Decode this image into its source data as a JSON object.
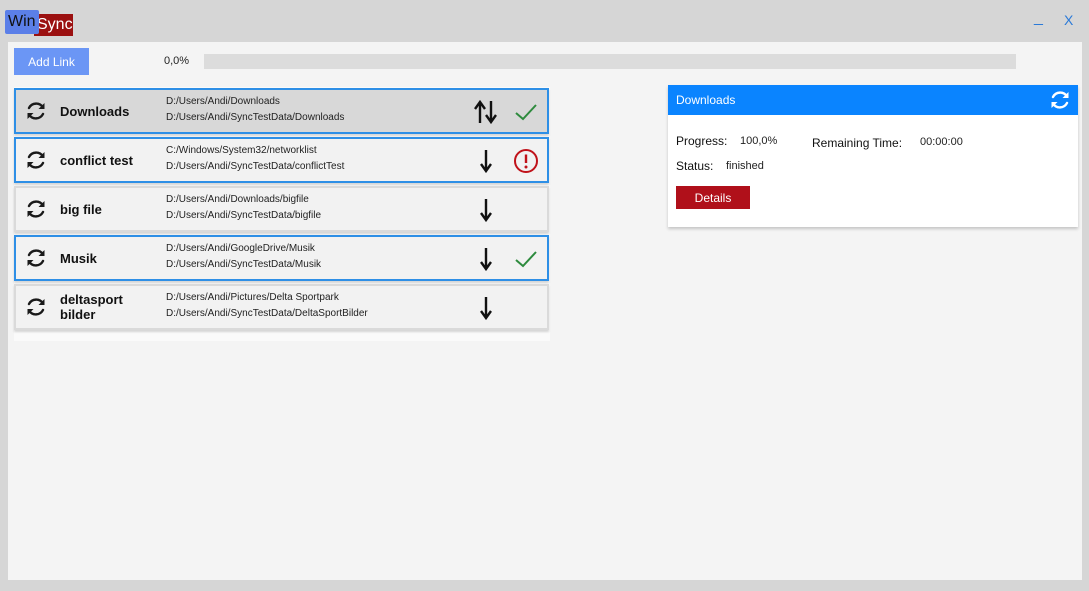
{
  "app": {
    "logo_win": "Win",
    "logo_sync": "Sync",
    "minimize": "_",
    "close": "X"
  },
  "toolbar": {
    "add_link_label": "Add Link",
    "overall_progress_text": "0,0%",
    "overall_progress_value": 0
  },
  "links": [
    {
      "name": "Downloads",
      "source": "D:/Users/Andi/Downloads",
      "target": "D:/Users/Andi/SyncTestData/Downloads",
      "direction": "bidirectional-arrows-icon",
      "status": "checkmark-icon",
      "selected": true
    },
    {
      "name": "conflict test",
      "source": "C:/Windows/System32/networklist",
      "target": "D:/Users/Andi/SyncTestData/conflictTest",
      "direction": "down-arrow-icon",
      "status": "error-icon",
      "selected": true
    },
    {
      "name": "big file",
      "source": "D:/Users/Andi/Downloads/bigfile",
      "target": "D:/Users/Andi/SyncTestData/bigfile",
      "direction": "down-arrow-icon",
      "status": "none",
      "selected": false
    },
    {
      "name": "Musik",
      "source": "D:/Users/Andi/GoogleDrive/Musik",
      "target": "D:/Users/Andi/SyncTestData/Musik",
      "direction": "down-arrow-icon",
      "status": "checkmark-icon",
      "selected": true
    },
    {
      "name": "deltasport bilder",
      "source": "D:/Users/Andi/Pictures/Delta Sportpark",
      "target": "D:/Users/Andi/SyncTestData/DeltaSportBilder",
      "direction": "down-arrow-icon",
      "status": "none",
      "selected": false
    }
  ],
  "detail": {
    "title": "Downloads",
    "progress_label": "Progress:",
    "progress_value": "100,0%",
    "remaining_label": "Remaining Time:",
    "remaining_value": "00:00:00",
    "status_label": "Status:",
    "status_value": "finished",
    "details_button": "Details"
  },
  "colors": {
    "accent": "#0a84ff",
    "selected_border": "#2e8fe6",
    "button_blue": "#6b96f5",
    "button_red": "#b0101a",
    "success": "#2e8b3e",
    "error": "#c0121a",
    "window_controls": "#2b7ad8"
  }
}
